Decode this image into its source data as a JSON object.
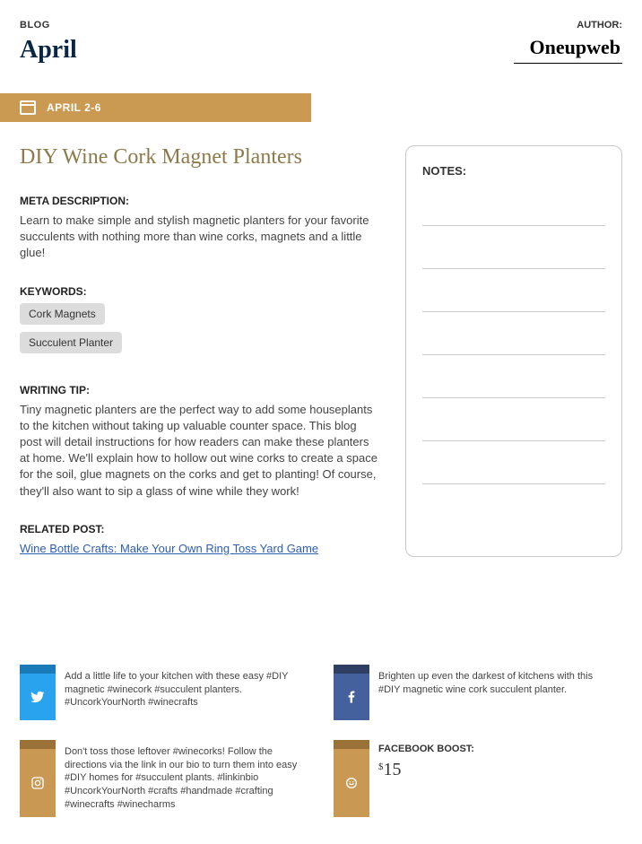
{
  "header": {
    "blog_label": "BLOG",
    "month": "April",
    "author_label": "AUTHOR:",
    "brand": "Oneupweb"
  },
  "date_bar": "APRIL 2-6",
  "title": "DIY Wine Cork Magnet Planters",
  "meta": {
    "label": "META DESCRIPTION:",
    "text": "Learn to make simple and stylish magnetic planters for your favorite succulents with nothing more than wine corks, magnets and a little glue!"
  },
  "keywords": {
    "label": "KEYWORDS:",
    "items": [
      "Cork Magnets",
      "Succulent Planter"
    ]
  },
  "tip": {
    "label": "WRITING TIP:",
    "text": "Tiny magnetic planters are the perfect way to add some houseplants to the kitchen without taking up valuable counter space. This blog post will detail instructions for how readers can make these planters at home. We'll explain how to hollow out wine corks to create a space for the soil, glue magnets on the corks and get to planting! Of course, they'll also want to sip a glass of wine while they work!"
  },
  "related": {
    "label": "RELATED POST:",
    "link": "Wine Bottle Crafts: Make Your Own Ring Toss Yard Game"
  },
  "notes_label": "NOTES:",
  "social": {
    "twitter": "Add a little life to your kitchen with these easy #DIY magnetic #winecork #succulent planters. #UncorkYourNorth #winecrafts",
    "facebook": "Brighten up even the darkest of kitchens with this #DIY magnetic wine cork succulent planter.",
    "instagram": "Don't toss those leftover #winecorks! Follow the directions via the link in our bio to turn them into easy #DIY homes for #succulent plants. #linkinbio #UncorkYourNorth #crafts #handmade #crafting #winecrafts #winecharms"
  },
  "boost": {
    "label": "FACEBOOK BOOST:",
    "currency": "$",
    "amount": "15"
  }
}
